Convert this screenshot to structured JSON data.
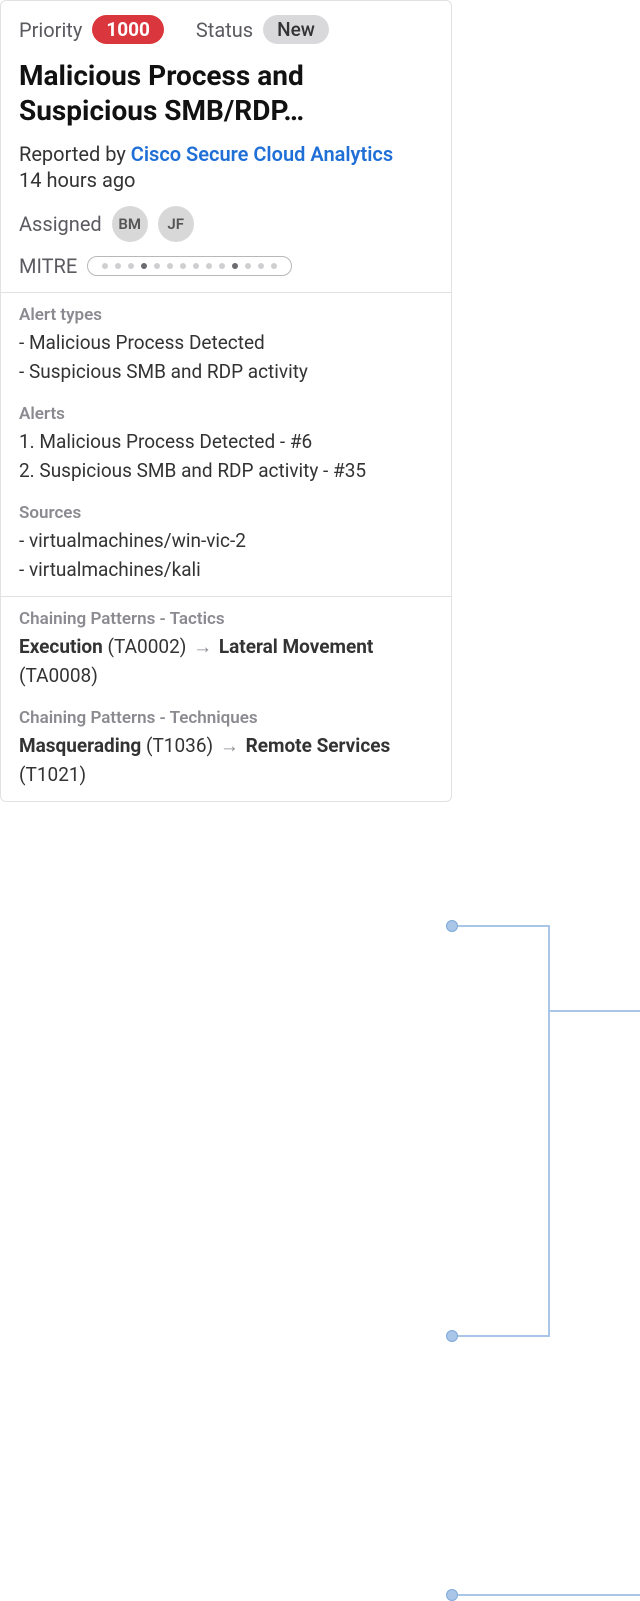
{
  "header": {
    "priority_label": "Priority",
    "priority_value": "1000",
    "status_label": "Status",
    "status_value": "New"
  },
  "title": "Malicious Process and Suspicious SMB/RDP…",
  "reported": {
    "prefix": "Reported by",
    "source": "Cisco Secure Cloud Analytics",
    "time_ago": "14 hours ago"
  },
  "assigned": {
    "label": "Assigned",
    "users": [
      "BM",
      "JF"
    ]
  },
  "mitre": {
    "label": "MITRE",
    "dots": [
      0,
      0,
      0,
      1,
      0,
      0,
      0,
      0,
      0,
      0,
      1,
      0,
      0,
      0
    ]
  },
  "alert_types": {
    "heading": "Alert types",
    "items": [
      "Malicious Process Detected",
      "Suspicious SMB and RDP activity"
    ]
  },
  "alerts": {
    "heading": "Alerts",
    "items": [
      "Malicious Process Detected - #6",
      "Suspicious SMB and RDP activity - #35"
    ]
  },
  "sources": {
    "heading": "Sources",
    "items": [
      "virtualmachines/win-vic-2",
      "virtualmachines/kali"
    ]
  },
  "chain_tactics": {
    "heading": "Chaining Patterns - Tactics",
    "a_name": "Execution",
    "a_code": "(TA0002)",
    "b_name": "Lateral Movement",
    "b_code": "(TA0008)"
  },
  "chain_techniques": {
    "heading": "Chaining Patterns - Techniques",
    "a_name": "Masquerading",
    "a_code": "(T1036)",
    "b_name": "Remote Services",
    "b_code": "(T1021)"
  }
}
